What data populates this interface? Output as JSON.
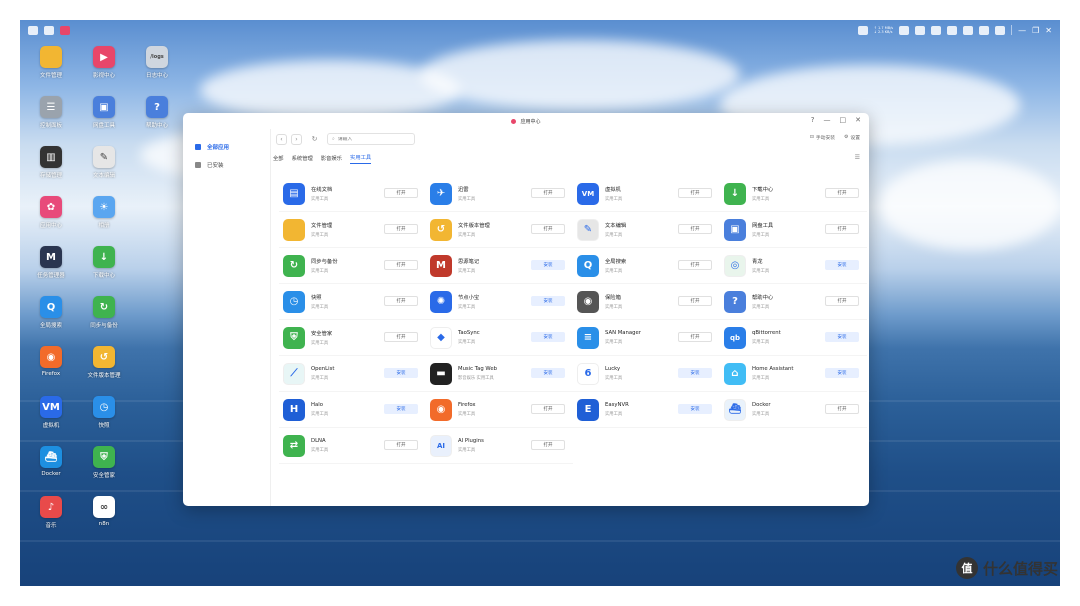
{
  "topbar": {
    "net_up": "↑ 1.7 MB/s",
    "net_down": "↓ 2.3 KB/s"
  },
  "desktop_icons": [
    {
      "label": "文件管理",
      "color": "#f2b632",
      "glyph": ""
    },
    {
      "label": "影视中心",
      "color": "#e8466a",
      "glyph": "▶"
    },
    {
      "label": "日志中心",
      "color": "#cfd6df",
      "glyph": "/logs"
    },
    {
      "label": "控制面板",
      "color": "#9aa3ad",
      "glyph": "☰"
    },
    {
      "label": "网盘工具",
      "color": "#4a7fdc",
      "glyph": "▣"
    },
    {
      "label": "帮助中心",
      "color": "#4a7fdc",
      "glyph": "?"
    },
    {
      "label": "存储管理",
      "color": "#333333",
      "glyph": "▥"
    },
    {
      "label": "文本编辑",
      "color": "#e6e6e6",
      "glyph": "✎"
    },
    {
      "label": "应用中心",
      "color": "#e84a7a",
      "glyph": "✿"
    },
    {
      "label": "相册",
      "color": "#5aa6f0",
      "glyph": "☀"
    },
    {
      "label": "任务管理器",
      "color": "#2a3550",
      "glyph": "M"
    },
    {
      "label": "下载中心",
      "color": "#3fb34f",
      "glyph": "↓"
    },
    {
      "label": "全局搜索",
      "color": "#2a8fe8",
      "glyph": "Q"
    },
    {
      "label": "同步与备份",
      "color": "#3fb34f",
      "glyph": "↻"
    },
    {
      "label": "Firefox",
      "color": "#f26b2a",
      "glyph": "◉"
    },
    {
      "label": "文件版本管理",
      "color": "#f2b632",
      "glyph": "↺"
    },
    {
      "label": "虚拟机",
      "color": "#2a6ae8",
      "glyph": "VM"
    },
    {
      "label": "快照",
      "color": "#2a8fe8",
      "glyph": "◷"
    },
    {
      "label": "Docker",
      "color": "#1d8fe0",
      "glyph": "⛴"
    },
    {
      "label": "安全管家",
      "color": "#3fb34f",
      "glyph": "⛨"
    },
    {
      "label": "音乐",
      "color": "#e84a4a",
      "glyph": "♪"
    },
    {
      "label": "n8n",
      "color": "#ffffff",
      "glyph": "∞"
    }
  ],
  "window": {
    "title": "应用中心",
    "controls": [
      "?",
      "—",
      "□",
      "✕"
    ]
  },
  "sidebar": {
    "items": [
      {
        "label": "全部应用"
      },
      {
        "label": "已安装"
      }
    ]
  },
  "toolbar": {
    "back": "‹",
    "forward": "›",
    "refresh": "↻",
    "search_placeholder": "请输入",
    "manual_install": "手动安装",
    "settings": "设置"
  },
  "tabs": [
    "全部",
    "系统管理",
    "影音娱乐",
    "实用工具"
  ],
  "apps": [
    {
      "name": "在线文档",
      "category": "实用工具",
      "action": "打开",
      "color": "#2a6ae8",
      "glyph": "▤"
    },
    {
      "name": "迅雷",
      "category": "实用工具",
      "action": "打开",
      "color": "#2a7ee8",
      "glyph": "✈"
    },
    {
      "name": "虚拟机",
      "category": "实用工具",
      "action": "打开",
      "color": "#2a6ae8",
      "glyph": "VM"
    },
    {
      "name": "下载中心",
      "category": "实用工具",
      "action": "打开",
      "color": "#3fb34f",
      "glyph": "↓"
    },
    {
      "name": "文件管理",
      "category": "实用工具",
      "action": "打开",
      "color": "#f2b632",
      "glyph": ""
    },
    {
      "name": "文件版本管理",
      "category": "实用工具",
      "action": "打开",
      "color": "#f2b632",
      "glyph": "↺"
    },
    {
      "name": "文本编辑",
      "category": "实用工具",
      "action": "打开",
      "color": "#e6e6e6",
      "glyph": "✎"
    },
    {
      "name": "网盘工具",
      "category": "实用工具",
      "action": "打开",
      "color": "#4a7fdc",
      "glyph": "▣"
    },
    {
      "name": "同步与备份",
      "category": "实用工具",
      "action": "打开",
      "color": "#3fb34f",
      "glyph": "↻"
    },
    {
      "name": "思源笔记",
      "category": "实用工具",
      "action": "安装",
      "color": "#c0392b",
      "glyph": "M"
    },
    {
      "name": "全局搜索",
      "category": "实用工具",
      "action": "打开",
      "color": "#2a8fe8",
      "glyph": "Q"
    },
    {
      "name": "青龙",
      "category": "实用工具",
      "action": "安装",
      "color": "#e9f5ec",
      "glyph": "◎"
    },
    {
      "name": "快照",
      "category": "实用工具",
      "action": "打开",
      "color": "#2a8fe8",
      "glyph": "◷"
    },
    {
      "name": "节点小宝",
      "category": "实用工具",
      "action": "安装",
      "color": "#2a6ae8",
      "glyph": "✺"
    },
    {
      "name": "保险箱",
      "category": "实用工具",
      "action": "打开",
      "color": "#555555",
      "glyph": "◉"
    },
    {
      "name": "帮助中心",
      "category": "实用工具",
      "action": "打开",
      "color": "#4a7fdc",
      "glyph": "?"
    },
    {
      "name": "安全管家",
      "category": "实用工具",
      "action": "打开",
      "color": "#3fb34f",
      "glyph": "⛨"
    },
    {
      "name": "TaoSync",
      "category": "实用工具",
      "action": "安装",
      "color": "#ffffff",
      "glyph": "◆"
    },
    {
      "name": "SAN Manager",
      "category": "实用工具",
      "action": "打开",
      "color": "#2a8fe8",
      "glyph": "≡"
    },
    {
      "name": "qBittorrent",
      "category": "实用工具",
      "action": "安装",
      "color": "#2a7ee8",
      "glyph": "qb"
    },
    {
      "name": "OpenList",
      "category": "实用工具",
      "action": "安装",
      "color": "#e8f6f6",
      "glyph": "⟋"
    },
    {
      "name": "Music Tag Web",
      "category": "影音娱乐  实用工具",
      "action": "安装",
      "color": "#222222",
      "glyph": "▬"
    },
    {
      "name": "Lucky",
      "category": "实用工具",
      "action": "安装",
      "color": "#ffffff",
      "glyph": "6"
    },
    {
      "name": "Home Assistant",
      "category": "实用工具",
      "action": "安装",
      "color": "#41bdf5",
      "glyph": "⌂"
    },
    {
      "name": "Halo",
      "category": "实用工具",
      "action": "安装",
      "color": "#1f5fd6",
      "glyph": "H"
    },
    {
      "name": "Firefox",
      "category": "实用工具",
      "action": "打开",
      "color": "#f26b2a",
      "glyph": "◉"
    },
    {
      "name": "EasyNVR",
      "category": "实用工具",
      "action": "安装",
      "color": "#1f5fd6",
      "glyph": "E"
    },
    {
      "name": "Docker",
      "category": "实用工具",
      "action": "打开",
      "color": "#e9f2fb",
      "glyph": "⛴"
    },
    {
      "name": "DLNA",
      "category": "实用工具",
      "action": "打开",
      "color": "#3fb34f",
      "glyph": "⇄"
    },
    {
      "name": "AI Plugins",
      "category": "实用工具",
      "action": "打开",
      "color": "#e9f0fc",
      "glyph": "AI"
    }
  ],
  "watermark": {
    "logo": "值",
    "text": "什么值得买"
  }
}
